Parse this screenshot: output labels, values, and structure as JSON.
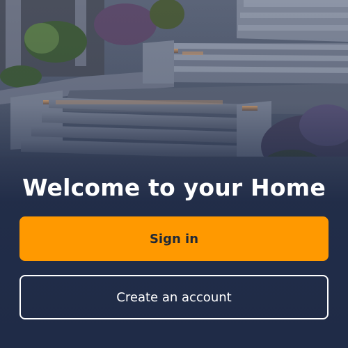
{
  "welcome": {
    "title": "Welcome to your Home"
  },
  "actions": {
    "sign_in_label": "Sign in",
    "create_account_label": "Create an account"
  },
  "colors": {
    "primary_button": "#ff9900",
    "primary_text": "#1f2937",
    "background_navy": "#1f2b45",
    "secondary_border": "#ffffff"
  },
  "background_image": {
    "subject": "outdoor-stairs-with-lights"
  }
}
